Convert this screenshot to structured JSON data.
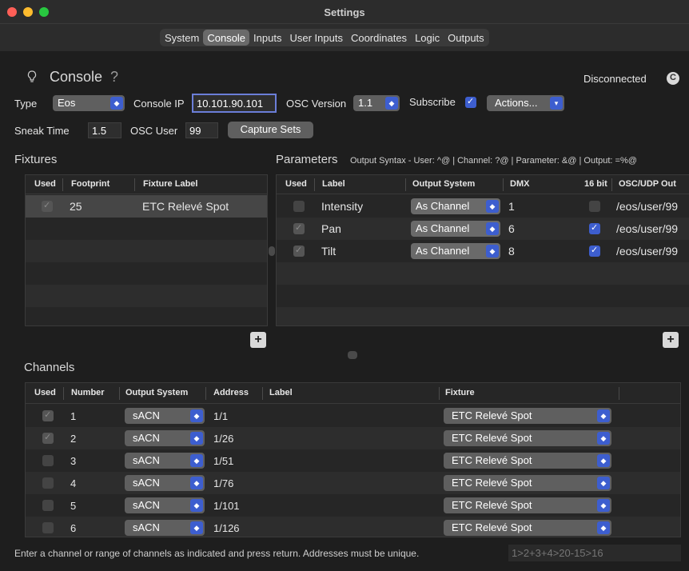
{
  "window": {
    "title": "Settings"
  },
  "tabs": [
    "System",
    "Console",
    "Inputs",
    "User Inputs",
    "Coordinates",
    "Logic",
    "Outputs"
  ],
  "header": {
    "section_title": "Console",
    "help": "?",
    "status": "Disconnected"
  },
  "form": {
    "type_label": "Type",
    "type_value": "Eos",
    "console_ip_label": "Console IP",
    "console_ip_value": "10.101.90.101",
    "osc_version_label": "OSC Version",
    "osc_version_value": "1.1",
    "subscribe_label": "Subscribe",
    "actions_label": "Actions...",
    "sneak_time_label": "Sneak Time",
    "sneak_time_value": "1.5",
    "osc_user_label": "OSC User",
    "osc_user_value": "99",
    "capture_sets_label": "Capture Sets"
  },
  "fixtures": {
    "title": "Fixtures",
    "columns": [
      "Used",
      "Footprint",
      "Fixture Label"
    ],
    "rows": [
      {
        "used": true,
        "footprint": "25",
        "label": "ETC Relevé Spot"
      }
    ]
  },
  "parameters": {
    "title": "Parameters",
    "syntax": "Output Syntax - User: ^@ | Channel: ?@  |  Parameter: &@  |  Output: =%@",
    "columns": [
      "Used",
      "Label",
      "Output System",
      "DMX",
      "16 bit",
      "OSC/UDP Out"
    ],
    "rows": [
      {
        "used": false,
        "label": "Intensity",
        "output_system": "As Channel",
        "dmx": "1",
        "bit16": false,
        "osc": "/eos/user/99"
      },
      {
        "used": true,
        "label": "Pan",
        "output_system": "As Channel",
        "dmx": "6",
        "bit16": true,
        "osc": "/eos/user/99"
      },
      {
        "used": true,
        "label": "Tilt",
        "output_system": "As Channel",
        "dmx": "8",
        "bit16": true,
        "osc": "/eos/user/99"
      }
    ]
  },
  "channels": {
    "title": "Channels",
    "columns": [
      "Used",
      "Number",
      "Output System",
      "Address",
      "Label",
      "Fixture"
    ],
    "rows": [
      {
        "used": true,
        "number": "1",
        "output_system": "sACN",
        "address": "1/1",
        "label": "",
        "fixture": "ETC Relevé Spot"
      },
      {
        "used": true,
        "number": "2",
        "output_system": "sACN",
        "address": "1/26",
        "label": "",
        "fixture": "ETC Relevé Spot"
      },
      {
        "used": false,
        "number": "3",
        "output_system": "sACN",
        "address": "1/51",
        "label": "",
        "fixture": "ETC Relevé Spot"
      },
      {
        "used": false,
        "number": "4",
        "output_system": "sACN",
        "address": "1/76",
        "label": "",
        "fixture": "ETC Relevé Spot"
      },
      {
        "used": false,
        "number": "5",
        "output_system": "sACN",
        "address": "1/101",
        "label": "",
        "fixture": "ETC Relevé Spot"
      },
      {
        "used": false,
        "number": "6",
        "output_system": "sACN",
        "address": "1/126",
        "label": "",
        "fixture": "ETC Relevé Spot"
      }
    ]
  },
  "footer": {
    "hint": "Enter a channel or range of channels as indicated and press return. Addresses must be unique.",
    "placeholder": "1>2+3+4>20-15>16"
  },
  "icons": {
    "bulb": "lightbulb-icon",
    "status": "connection-icon",
    "stepper": "stepper-icon",
    "chevron": "chevron-down-icon",
    "plus": "plus-icon"
  },
  "colors": {
    "accent": "#3d5ecf",
    "background": "#1e1e1e"
  }
}
